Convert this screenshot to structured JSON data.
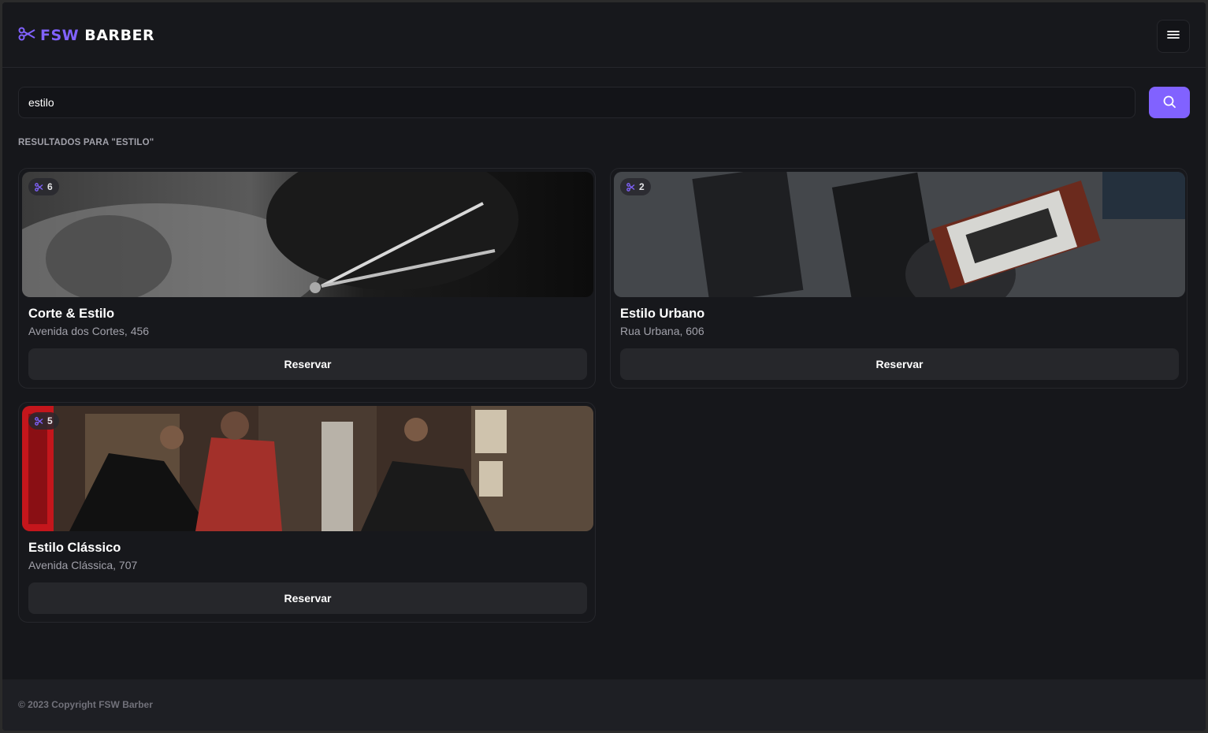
{
  "app": {
    "logo_fsw": "FSW",
    "logo_barber": "BARBER",
    "menu_icon": "menu-icon"
  },
  "search": {
    "value": "estilo",
    "button_icon": "search-icon"
  },
  "results": {
    "title": "RESULTADOS PARA \"ESTILO\""
  },
  "barbershops": [
    {
      "rating": "6",
      "name": "Corte & Estilo",
      "address": "Avenida dos Cortes, 456",
      "button": "Reservar"
    },
    {
      "rating": "2",
      "name": "Estilo Urbano",
      "address": "Rua Urbana, 606",
      "button": "Reservar"
    },
    {
      "rating": "5",
      "name": "Estilo Clássico",
      "address": "Avenida Clássica, 707",
      "button": "Reservar"
    }
  ],
  "footer": {
    "copyright": "© 2023 Copyright FSW Barber"
  },
  "colors": {
    "accent": "#8162ff",
    "background": "#16171b",
    "card": "#17181c",
    "border": "#26272c"
  }
}
